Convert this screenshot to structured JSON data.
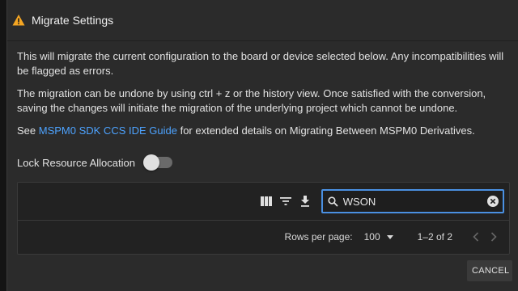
{
  "dialog": {
    "title": "Migrate Settings",
    "paragraph1": "This will migrate the current configuration to the board or device selected below. Any incompatibilities will be flagged as errors.",
    "paragraph2": "The migration can be undone by using ctrl + z or the history view. Once satisfied with the conversion, saving the changes will initiate the migration of the underlying project which cannot be undone.",
    "paragraph3_prefix": "See ",
    "paragraph3_link": "MSPM0 SDK CCS IDE Guide",
    "paragraph3_suffix": " for extended details on Migrating Between MSPM0 Derivatives.",
    "lock_label": "Lock Resource Allocation",
    "lock_enabled": false,
    "cancel_label": "CANCEL"
  },
  "table": {
    "toolbar_icons": [
      "columns-icon",
      "filter-icon",
      "download-icon"
    ],
    "search": {
      "value": "WSON",
      "icon": "search-icon"
    },
    "footer": {
      "rows_per_page_label": "Rows per page:",
      "rows_per_page_value": "100",
      "range": "1–2 of 2"
    }
  },
  "colors": {
    "accent": "#4da3ff",
    "warning": "#f5a623",
    "focus_border": "#4a90e2"
  }
}
